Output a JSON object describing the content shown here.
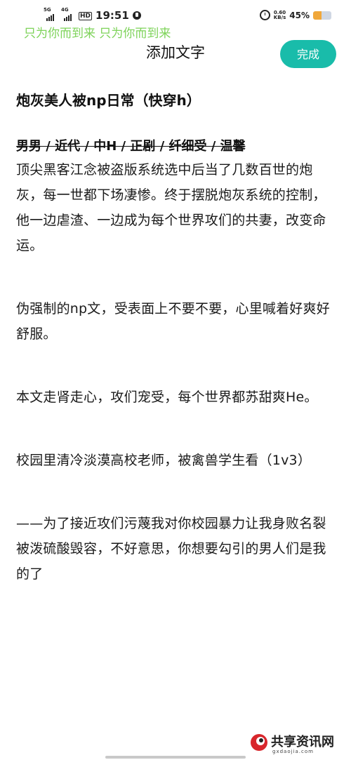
{
  "status_bar": {
    "signal1_label": "5G",
    "signal2_label": "4G",
    "hd_label": "HD",
    "time": "19:51",
    "speed_value": "0.60",
    "speed_unit": "KB/s",
    "battery_percent_text": "45%",
    "battery_level": 0.45
  },
  "watermark": {
    "text": "只为你而到来 只为你而到来"
  },
  "header": {
    "title": "添加文字",
    "done_label": "完成"
  },
  "article": {
    "title": "炮灰美人被np日常（快穿h）",
    "tags": "男男 / 近代 / 中H / 正剧 / 纤细受 / 温馨",
    "paragraphs": [
      "    顶尖黑客江念被盗版系统选中后当了几数百世的炮灰，每一世都下场凄惨。终于摆脱炮灰系统的控制，他一边虐渣、一边成为每个世界攻们的共妻，改变命运。",
      "        伪强制的np文，受表面上不要不要，心里喊着好爽好舒服。",
      "        本文走肾走心，攻们宠受，每个世界都苏甜爽He。",
      "        校园里清冷淡漠高校老师，被禽兽学生看（1v3）",
      "        ——为了接近攻们污蔑我对你校园暴力让我身败名裂被泼硫酸毁容，不好意思，你想要勾引的男人们是我的了"
    ]
  },
  "footer_logo": {
    "text": "共享资讯网",
    "subtext": "gxdaojia.com"
  },
  "colors": {
    "accent": "#19bcaa",
    "watermark": "#7ed35a",
    "battery_fill": "#f0a73a"
  }
}
